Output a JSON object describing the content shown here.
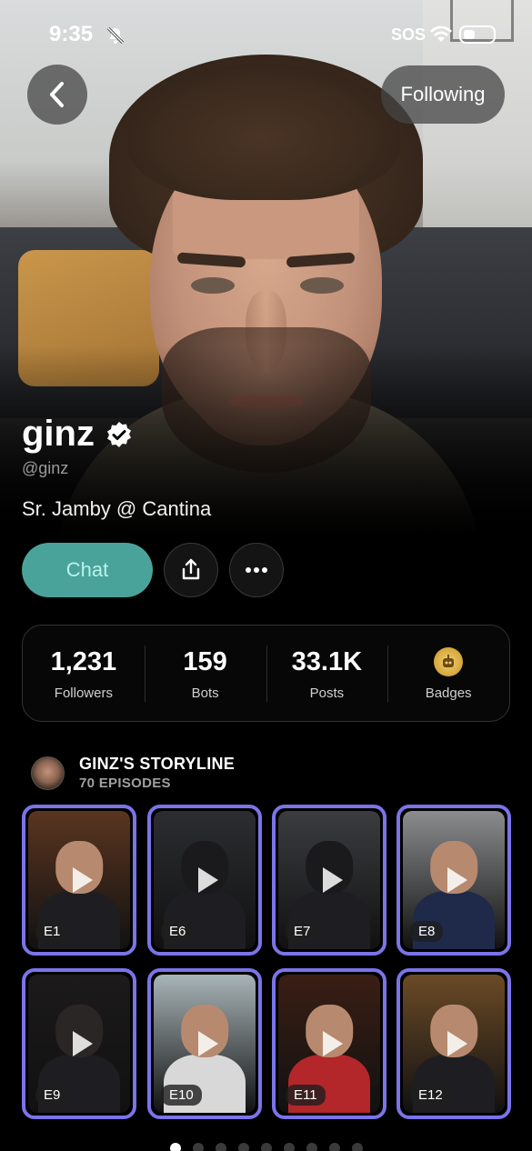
{
  "status_bar": {
    "time": "9:35",
    "carrier": "SOS"
  },
  "header": {
    "following_label": "Following"
  },
  "profile": {
    "name": "ginz",
    "handle": "@ginz",
    "bio": "Sr. Jamby @ Cantina",
    "verified": true
  },
  "actions": {
    "chat_label": "Chat"
  },
  "stats": [
    {
      "value": "1,231",
      "label": "Followers"
    },
    {
      "value": "159",
      "label": "Bots"
    },
    {
      "value": "33.1K",
      "label": "Posts"
    },
    {
      "value": "",
      "label": "Badges",
      "icon": "robot-badge-icon"
    }
  ],
  "storyline": {
    "title": "GINZ'S STORYLINE",
    "subtitle": "70 EPISODES",
    "episodes": [
      {
        "label": "E1",
        "scene": "dinner-portrait",
        "bg": "#5a3520"
      },
      {
        "label": "E6",
        "scene": "batman",
        "bg": "#2b2d30"
      },
      {
        "label": "E7",
        "scene": "batman-elevator",
        "bg": "#3a3c40"
      },
      {
        "label": "E8",
        "scene": "office-suit",
        "bg": "#8a8c8e"
      },
      {
        "label": "E9",
        "scene": "dark-wizard",
        "bg": "#1c1a1a"
      },
      {
        "label": "E10",
        "scene": "car-selfie",
        "bg": "#a9b4b8"
      },
      {
        "label": "E11",
        "scene": "red-dress",
        "bg": "#3a1e14"
      },
      {
        "label": "E12",
        "scene": "wizard-study",
        "bg": "#6b4a26"
      }
    ]
  },
  "pagination": {
    "count": 9,
    "active": 0
  },
  "colors": {
    "accent": "#4aa39a",
    "episode_border": "#7b74e8"
  }
}
